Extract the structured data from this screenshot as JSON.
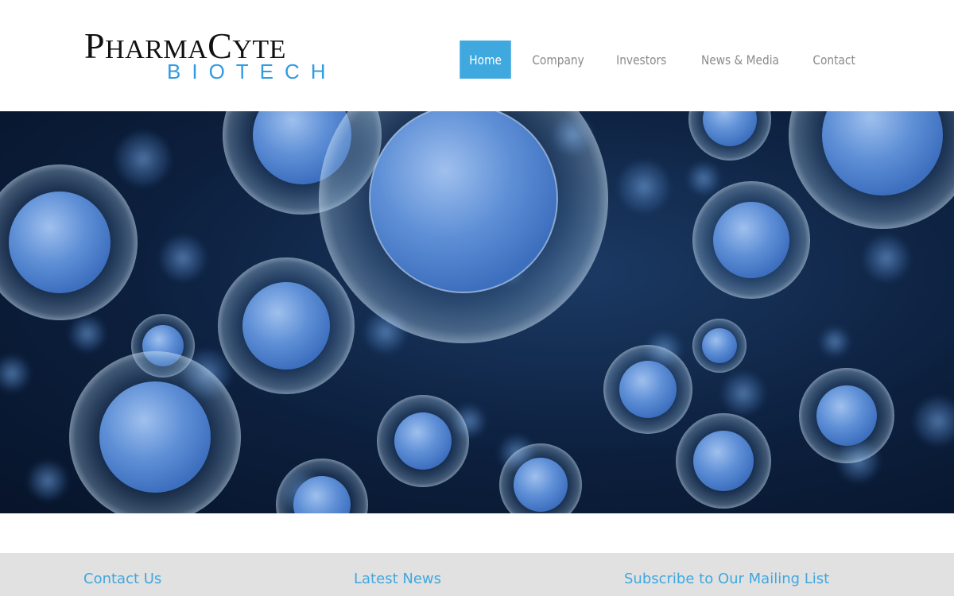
{
  "brand": {
    "logo_top_text": "PharmaCyte",
    "logo_bottom_text": "BIOTECH",
    "primary_color": "#111111",
    "accent_color": "#2f9be0"
  },
  "nav": {
    "items": [
      {
        "label": "Home",
        "active": true
      },
      {
        "label": "Company",
        "active": false
      },
      {
        "label": "Investors",
        "active": false
      },
      {
        "label": "News & Media",
        "active": false
      },
      {
        "label": "Contact",
        "active": false
      }
    ],
    "active_color": "#3fa8df"
  },
  "hero": {
    "image_subject": "blue cells"
  },
  "footer": {
    "headings": [
      {
        "label": "Contact Us"
      },
      {
        "label": "Latest News"
      },
      {
        "label": "Subscribe to Our Mailing List"
      }
    ],
    "background": "#e1e1e1",
    "heading_color": "#3fa8df"
  }
}
